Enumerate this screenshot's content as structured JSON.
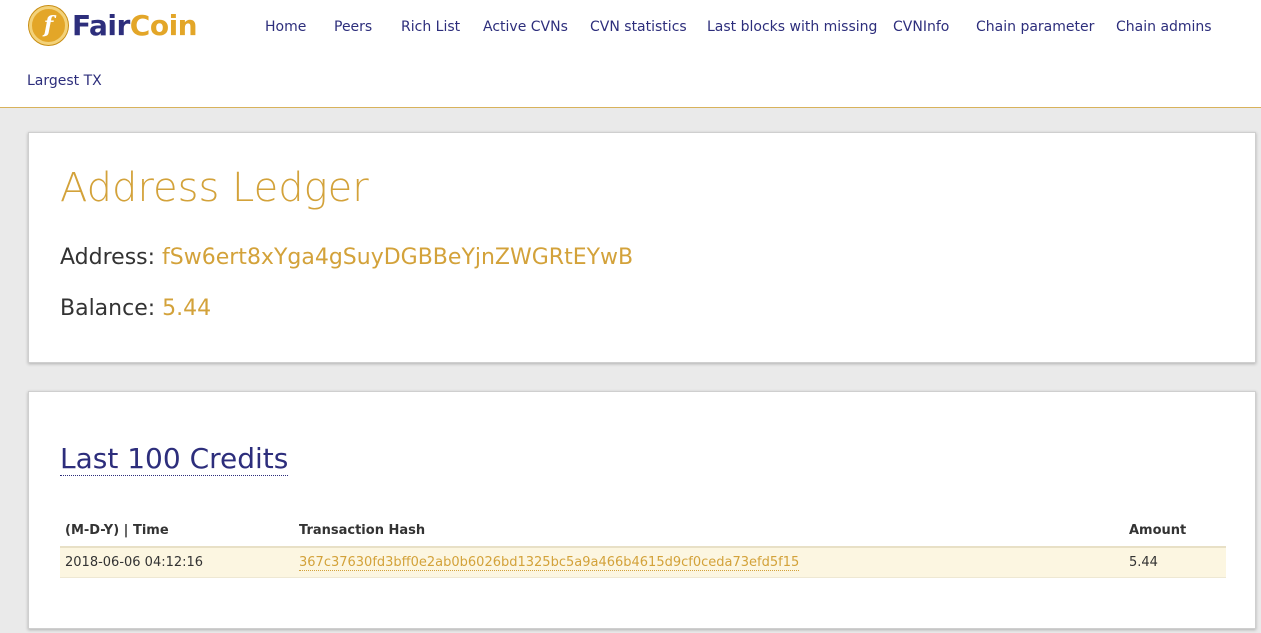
{
  "brand": {
    "coin_glyph": "f",
    "name_part1": "Fair",
    "name_part2": "Coin",
    "colors": {
      "primary": "#2d2e7c",
      "accent": "#e3a628"
    }
  },
  "nav": {
    "items": [
      {
        "label": "Home"
      },
      {
        "label": "Peers"
      },
      {
        "label": "Rich List"
      },
      {
        "label": "Active CVNs"
      },
      {
        "label": "CVN statistics"
      },
      {
        "label": "Last blocks with missing"
      },
      {
        "label": "CVNInfo"
      },
      {
        "label": "Chain parameter"
      },
      {
        "label": "Chain admins"
      },
      {
        "label": "Largest TX"
      }
    ]
  },
  "ledger": {
    "title": "Address Ledger",
    "address_label": "Address:",
    "address_value": "fSw6ert8xYga4gSuyDGBBeYjnZWGRtEYwB",
    "balance_label": "Balance:",
    "balance_value": "5.44"
  },
  "credits": {
    "title": "Last 100 Credits",
    "columns": [
      "(M-D-Y) | Time",
      "Transaction Hash",
      "Amount"
    ],
    "rows": [
      {
        "datetime": "2018-06-06 04:12:16",
        "hash": "367c37630fd3bff0e2ab0b6026bd1325bc5a9a466b4615d9cf0ceda73efd5f15",
        "amount": "5.44"
      }
    ]
  }
}
